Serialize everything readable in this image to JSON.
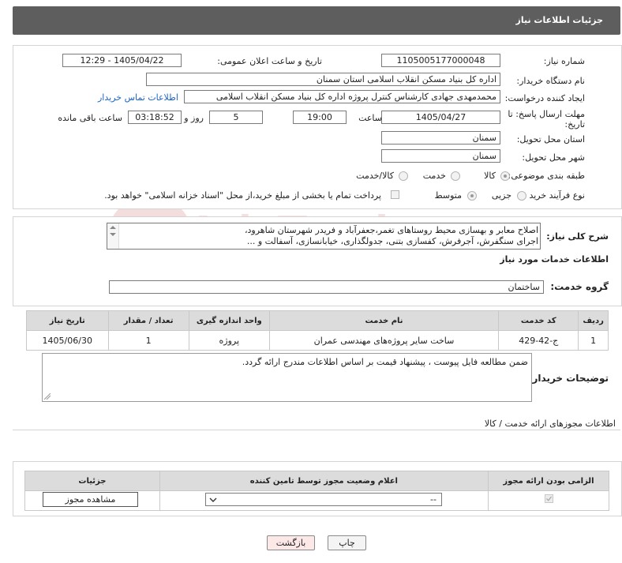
{
  "header": {
    "title": "جزئیات اطلاعات نیاز"
  },
  "info": {
    "need_number_label": "شماره نیاز:",
    "need_number": "1105005177000048",
    "announce_label": "تاریخ و ساعت اعلان عمومی:",
    "announce_value": "1405/04/22 - 12:29",
    "buyer_org_label": "نام دستگاه خریدار:",
    "buyer_org": "اداره کل بنیاد مسکن انقلاب اسلامی استان سمنان",
    "creator_label": "ایجاد کننده درخواست:",
    "creator": "محمدمهدی جهادی کارشناس کنترل پروژه اداره کل بنیاد مسکن انقلاب اسلامی",
    "contact_link": "اطلاعات تماس خریدار",
    "deadline_label_1": "مهلت ارسال پاسخ: تا",
    "deadline_label_2": "تاریخ:",
    "deadline_date": "1405/04/27",
    "time_label": "ساعت",
    "deadline_time": "19:00",
    "days_value": "5",
    "days_label": "روز و",
    "remaining_time": "03:18:52",
    "remaining_label": "ساعت باقی مانده",
    "province_label": "استان محل تحویل:",
    "province": "سمنان",
    "city_label": "شهر محل تحویل:",
    "city": "سمنان",
    "category_label": "طبقه بندی موضوعی:",
    "category_options": [
      "کالا",
      "خدمت",
      "کالا/خدمت"
    ],
    "process_label": "نوع فرآیند خرید :",
    "process_options": [
      "جزیی",
      "متوسط"
    ],
    "payment_note": "پرداخت تمام یا بخشی از مبلغ خرید،از محل \"اسناد خزانه اسلامی\" خواهد بود."
  },
  "description": {
    "label": "شرح کلی نیاز:",
    "lines": [
      "اصلاح معابر و بهسازی محیط روستاهای تغمر،جعفرآباد و فریدر شهرستان شاهرود،",
      "اجرای سنگفرش، آجرفرش، کفسازی بتنی، جدولگذاری، خیابانسازی، آسفالت و ..."
    ]
  },
  "services": {
    "section_title": "اطلاعات خدمات مورد نیاز",
    "group_label": "گروه خدمت:",
    "group_value": "ساختمان",
    "columns": [
      "ردیف",
      "کد خدمت",
      "نام خدمت",
      "واحد اندازه گیری",
      "تعداد / مقدار",
      "تاریخ نیاز"
    ],
    "rows": [
      [
        "1",
        "ج-42-429",
        "ساخت سایر پروژه‌های مهندسی عمران",
        "پروژه",
        "1",
        "1405/06/30"
      ]
    ]
  },
  "buyer_notes": {
    "label": "توضیحات خریدار:",
    "text": "ضمن مطالعه فایل پیوست ، پیشنهاد قیمت بر اساس اطلاعات مندرج ارائه گردد."
  },
  "permits": {
    "section_title": "اطلاعات مجوزهای ارائه خدمت / کالا",
    "columns": [
      "الزامی بودن ارائه مجوز",
      "اعلام وضعیت مجوز توسط تامین کننده",
      "جزئیات"
    ],
    "select_value": "--",
    "view_button": "مشاهده مجوز"
  },
  "actions": {
    "print": "چاپ",
    "back": "بازگشت"
  },
  "watermark": {
    "text": "AriaTender.net"
  },
  "colors": {
    "header_bg": "#5e5e5e",
    "link": "#1a64c8",
    "back_button_bg": "#fde8e8"
  }
}
